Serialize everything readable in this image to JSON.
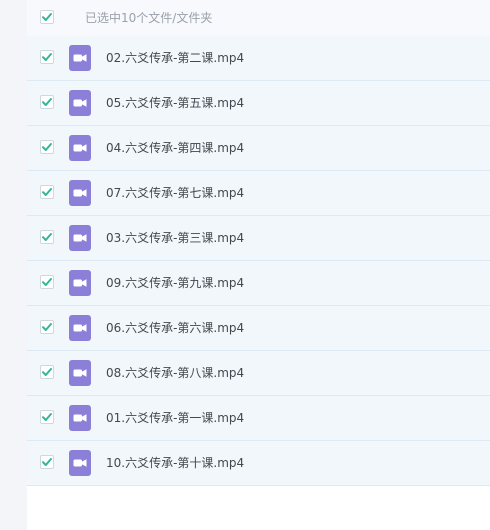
{
  "header": {
    "selection_text": "已选中10个文件/文件夹"
  },
  "icons": {
    "checkbox": "check-icon",
    "file": "video-file-icon"
  },
  "colors": {
    "check": "#35b597",
    "video_icon": "#8c7fd8",
    "row_selected_bg": "#f1f7fb"
  },
  "files": [
    {
      "name": "02.六爻传承-第二课.mp4",
      "checked": true
    },
    {
      "name": "05.六爻传承-第五课.mp4",
      "checked": true
    },
    {
      "name": "04.六爻传承-第四课.mp4",
      "checked": true
    },
    {
      "name": "07.六爻传承-第七课.mp4",
      "checked": true
    },
    {
      "name": "03.六爻传承-第三课.mp4",
      "checked": true
    },
    {
      "name": "09.六爻传承-第九课.mp4",
      "checked": true
    },
    {
      "name": "06.六爻传承-第六课.mp4",
      "checked": true
    },
    {
      "name": "08.六爻传承-第八课.mp4",
      "checked": true
    },
    {
      "name": "01.六爻传承-第一课.mp4",
      "checked": true
    },
    {
      "name": "10.六爻传承-第十课.mp4",
      "checked": true
    }
  ]
}
